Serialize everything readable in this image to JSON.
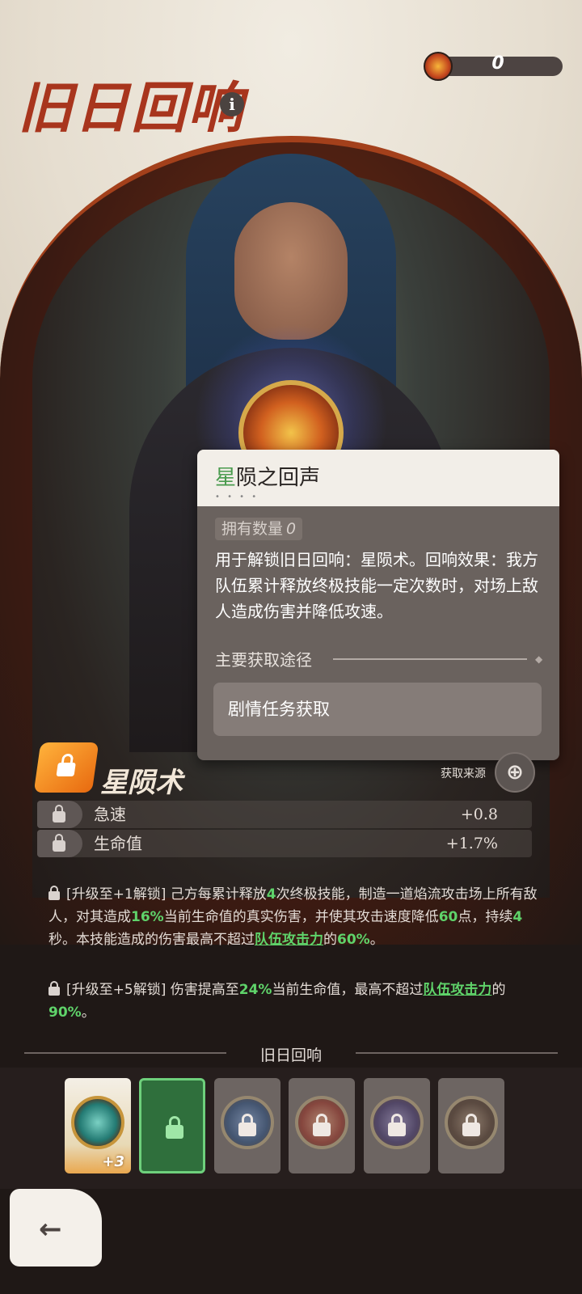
{
  "header": {
    "title": "旧日回响",
    "info_icon": "i",
    "currency_value": "0"
  },
  "tooltip": {
    "title_first": "星",
    "title_rest": "陨之回声",
    "dots": "• • • •",
    "owned_label": "拥有数量",
    "owned_value": "0",
    "description": "用于解锁旧日回响：星陨术。回响效果：我方队伍累计释放终极技能一定次数时，对场上敌人造成伤害并降低攻速。",
    "source_heading": "主要获取途径",
    "source_option": "剧情任务获取"
  },
  "skill": {
    "name": "星陨术",
    "source_label": "获取来源",
    "source_icon": "⊕",
    "stats": [
      {
        "name": "急速",
        "value": "+0.8"
      },
      {
        "name": "生命值",
        "value": "+1.7%"
      }
    ],
    "unlock1": {
      "tag": "[升级至+1解锁]",
      "t1": " 己方每累计释放",
      "n1": "4",
      "t2": "次终极技能，制造一道焰流攻击场上所有敌人，对其造成",
      "n2": "16%",
      "t3": "当前生命值的真实伤害，并使其攻击速度降低",
      "n3": "60",
      "t4": "点，持续",
      "n4": "4",
      "t5": "秒。本技能造成的伤害最高不超过",
      "link": "队伍攻击力",
      "t6": "的",
      "n5": "60%",
      "t7": "。"
    },
    "unlock2": {
      "tag": "[升级至+5解锁]",
      "t1": " 伤害提高至",
      "n1": "24%",
      "t2": "当前生命值，最高不超过",
      "link": "队伍攻击力",
      "t3": "的",
      "n2": "90%",
      "t4": "。"
    }
  },
  "echo_strip": {
    "title": "旧日回响",
    "owned_plus": "+3"
  },
  "colors": {
    "title_red": "#a8351d",
    "highlight_green": "#5fd36a",
    "badge_orange": "#e86a10"
  }
}
